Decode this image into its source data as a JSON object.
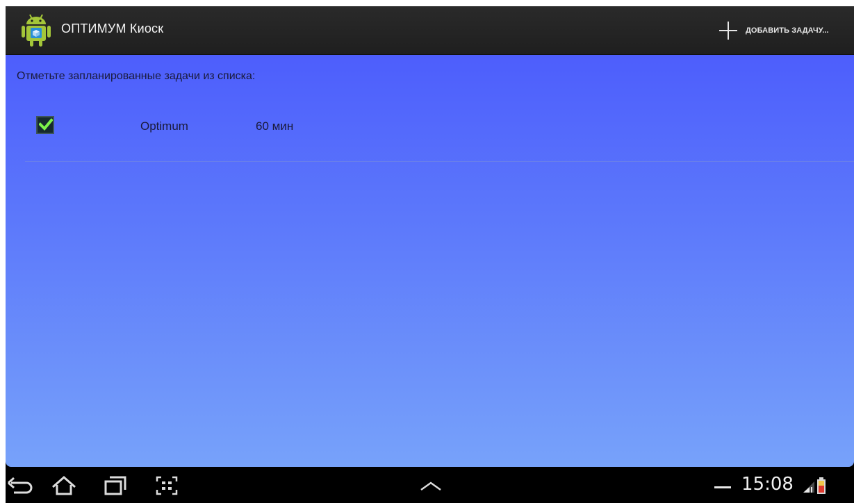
{
  "app": {
    "title": "ОПТИМУМ Киоск",
    "icon": "android-app-icon"
  },
  "actionbar": {
    "add_task_label": "ДОБАВИТЬ ЗАДАЧУ...",
    "add_icon": "plus-icon"
  },
  "content": {
    "instruction": "Отметьте запланированные задачи из списка:",
    "tasks": [
      {
        "name": "Optimum",
        "duration": "60 мин",
        "checked": true
      }
    ]
  },
  "systembar": {
    "nav": [
      "back-icon",
      "home-icon",
      "recent-apps-icon",
      "screenshot-icon"
    ],
    "center": "chevron-up-icon",
    "clock": "15:08",
    "status_icons": [
      "minus-icon",
      "signal-icon",
      "battery-icon"
    ]
  },
  "colors": {
    "actionbar_bg": "#222222",
    "content_gradient_top": "#4d5efc",
    "content_gradient_bottom": "#77a2fa",
    "checkbox_check": "#7cf24a"
  }
}
